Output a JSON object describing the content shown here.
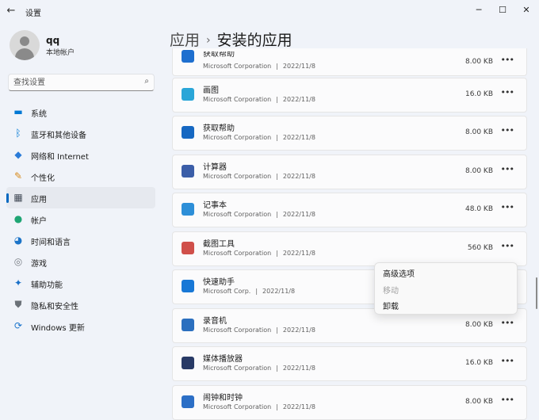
{
  "window": {
    "title": "设置",
    "back_icon": "arrow-left-icon",
    "minimize": "─",
    "maximize": "☐",
    "close": "✕"
  },
  "user": {
    "name": "qq",
    "account_type": "本地帐户"
  },
  "search": {
    "placeholder": "查找设置",
    "icon": "⌕"
  },
  "sidebar": {
    "items": [
      {
        "label": "系统",
        "icon": "monitor-icon",
        "glyph": "▬",
        "color": "#0078d4"
      },
      {
        "label": "蓝牙和其他设备",
        "icon": "bluetooth-icon",
        "glyph": "ᛒ",
        "color": "#0078d4"
      },
      {
        "label": "网络和 Internet",
        "icon": "wifi-icon",
        "glyph": "◆",
        "color": "#2a7bd8"
      },
      {
        "label": "个性化",
        "icon": "brush-icon",
        "glyph": "✎",
        "color": "#d7891a"
      },
      {
        "label": "应用",
        "icon": "apps-icon",
        "glyph": "▦",
        "color": "#444c58",
        "active": true
      },
      {
        "label": "帐户",
        "icon": "person-icon",
        "glyph": "●",
        "color": "#1fa574"
      },
      {
        "label": "时间和语言",
        "icon": "globe-clock-icon",
        "glyph": "◕",
        "color": "#1c74c8"
      },
      {
        "label": "游戏",
        "icon": "gamepad-icon",
        "glyph": "◎",
        "color": "#7a7f86"
      },
      {
        "label": "辅助功能",
        "icon": "accessibility-icon",
        "glyph": "✦",
        "color": "#1a70c8"
      },
      {
        "label": "隐私和安全性",
        "icon": "shield-icon",
        "glyph": "⛊",
        "color": "#6b7178"
      },
      {
        "label": "Windows 更新",
        "icon": "update-icon",
        "glyph": "⟳",
        "color": "#1a74cc"
      }
    ]
  },
  "breadcrumb": {
    "parent": "应用",
    "separator": "›",
    "current": "安装的应用"
  },
  "apps": [
    {
      "name": "获取帮助",
      "publisher": "Microsoft Corporation",
      "date": "2022/11/8",
      "size": "8.00 KB",
      "icon": "feedback-icon",
      "color": "#1e6fcf"
    },
    {
      "name": "画图",
      "publisher": "Microsoft Corporation",
      "date": "2022/11/8",
      "size": "16.0 KB",
      "icon": "paint-icon",
      "color": "#2aa6d8"
    },
    {
      "name": "获取帮助",
      "publisher": "Microsoft Corporation",
      "date": "2022/11/8",
      "size": "8.00 KB",
      "icon": "help-icon",
      "color": "#1668c2"
    },
    {
      "name": "计算器",
      "publisher": "Microsoft Corporation",
      "date": "2022/11/8",
      "size": "8.00 KB",
      "icon": "calculator-icon",
      "color": "#3b5ea8"
    },
    {
      "name": "记事本",
      "publisher": "Microsoft Corporation",
      "date": "2022/11/8",
      "size": "48.0 KB",
      "icon": "notepad-icon",
      "color": "#2d8fd8"
    },
    {
      "name": "截图工具",
      "publisher": "Microsoft Corporation",
      "date": "2022/11/8",
      "size": "560 KB",
      "icon": "snipping-tool-icon",
      "color": "#d0504a"
    },
    {
      "name": "快速助手",
      "publisher": "Microsoft Corp.",
      "date": "2022/11/8",
      "size": "",
      "icon": "quick-assist-icon",
      "color": "#1878d6"
    },
    {
      "name": "录音机",
      "publisher": "Microsoft Corporation",
      "date": "2022/11/8",
      "size": "8.00 KB",
      "icon": "recorder-icon",
      "color": "#2b6fbf"
    },
    {
      "name": "媒体播放器",
      "publisher": "Microsoft Corporation",
      "date": "2022/11/8",
      "size": "16.0 KB",
      "icon": "media-player-icon",
      "color": "#283a66"
    },
    {
      "name": "闹钟和时钟",
      "publisher": "Microsoft Corporation",
      "date": "2022/11/8",
      "size": "8.00 KB",
      "icon": "clock-icon",
      "color": "#2c6fc6"
    }
  ],
  "meta_separator": "|",
  "more_glyph": "•••",
  "context_menu": {
    "items": [
      {
        "label": "高级选项",
        "disabled": false
      },
      {
        "label": "移动",
        "disabled": true
      },
      {
        "label": "卸载",
        "disabled": false
      }
    ]
  }
}
